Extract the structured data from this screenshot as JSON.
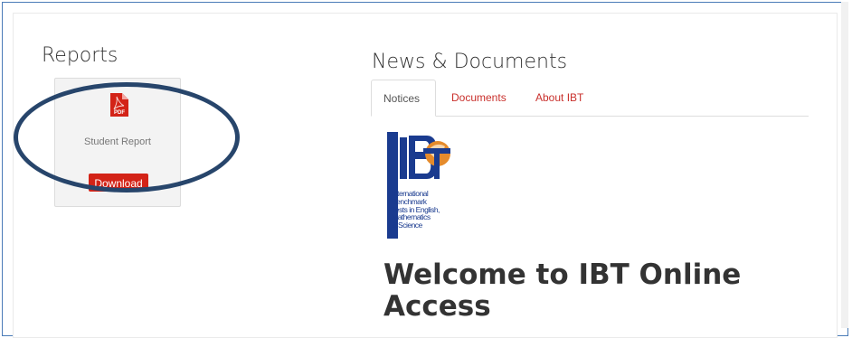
{
  "reports": {
    "title": "Reports",
    "card": {
      "icon": "pdf-file-icon",
      "icon_text": "PDF",
      "label": "Student Report",
      "button": "Download"
    }
  },
  "news": {
    "title": "News & Documents",
    "tabs": [
      {
        "label": "Notices",
        "active": true
      },
      {
        "label": "Documents",
        "active": false
      },
      {
        "label": "About IBT",
        "active": false
      }
    ],
    "logo": {
      "letters": "IBT",
      "lines": [
        "International",
        "Benchmark",
        "Tests in English,",
        "Mathematics",
        "& Science"
      ]
    },
    "welcome": "Welcome to IBT Online Access"
  },
  "colors": {
    "accent_red": "#d32317",
    "tab_red": "#c9302c",
    "annotation_ellipse": "#27456b",
    "logo_blue": "#1a3b8f"
  }
}
